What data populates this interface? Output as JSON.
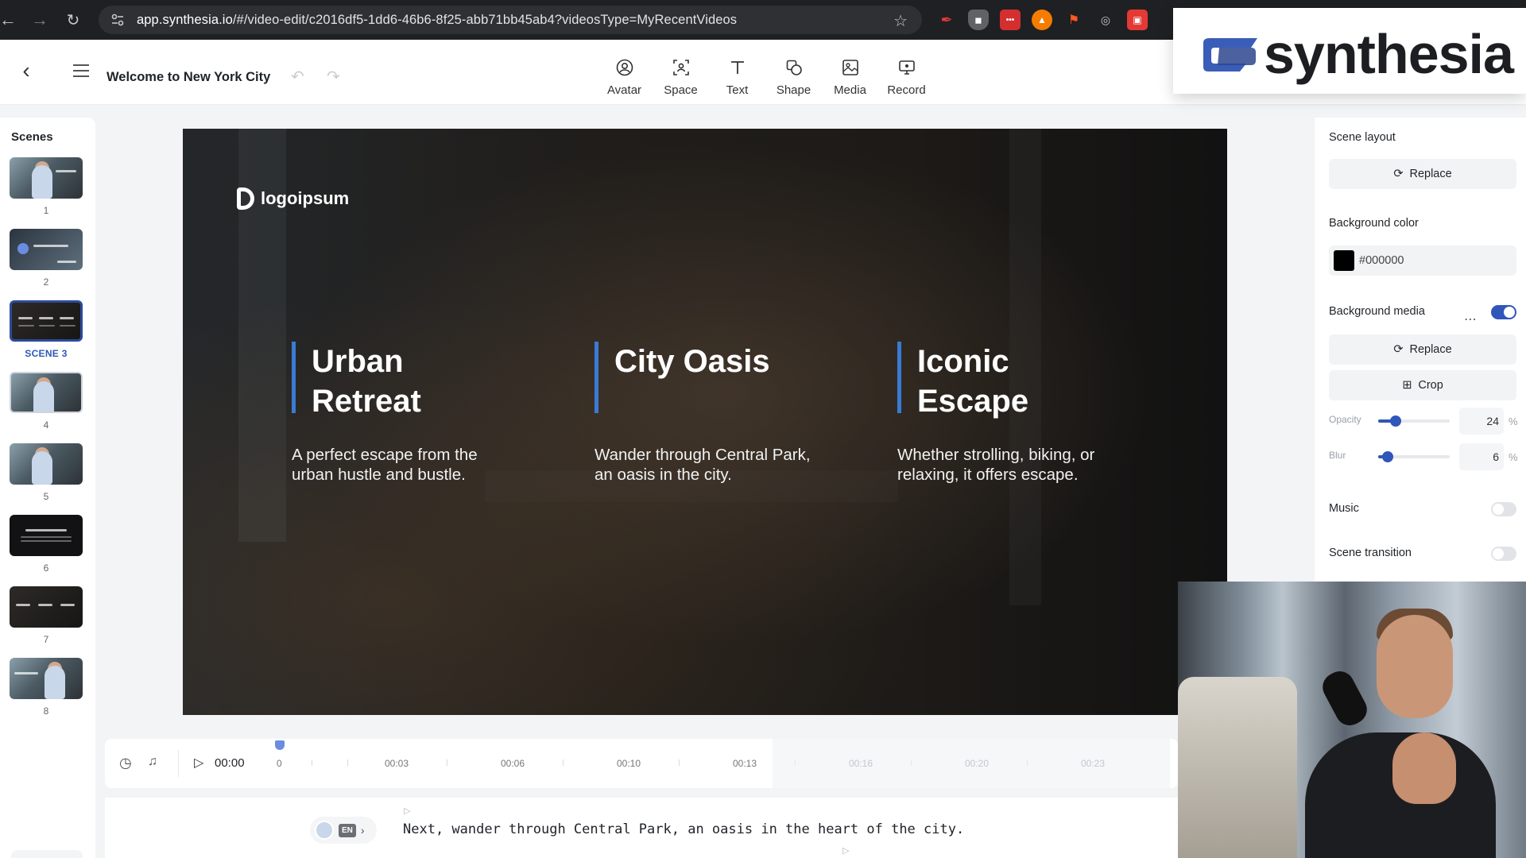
{
  "browser": {
    "url_host": "app.synthesia.io",
    "url_path": "/#/video-edit/c2016df5-1dd6-46b6-8f25-abb71bb45ab4?videosType=MyRecentVideos"
  },
  "header": {
    "video_title": "Welcome to New York City",
    "tools": [
      {
        "label": "Avatar",
        "icon": "avatar-icon"
      },
      {
        "label": "Space",
        "icon": "space-icon"
      },
      {
        "label": "Text",
        "icon": "text-icon"
      },
      {
        "label": "Shape",
        "icon": "shape-icon"
      },
      {
        "label": "Media",
        "icon": "media-icon"
      },
      {
        "label": "Record",
        "icon": "record-icon"
      }
    ]
  },
  "brand_overlay": {
    "wordmark": "synthesia"
  },
  "sidebar": {
    "title": "Scenes",
    "scenes": [
      {
        "label": "1",
        "style": "photo"
      },
      {
        "label": "2",
        "style": "photo"
      },
      {
        "label": "SCENE 3",
        "style": "dark",
        "selected": true
      },
      {
        "label": "4",
        "style": "photo"
      },
      {
        "label": "5",
        "style": "photo"
      },
      {
        "label": "6",
        "style": "dark"
      },
      {
        "label": "7",
        "style": "dark"
      },
      {
        "label": "8",
        "style": "photo"
      }
    ],
    "add_label": "+"
  },
  "canvas": {
    "logo_text": "logoipsum",
    "columns": [
      {
        "title_line1": "Urban",
        "title_line2": "Retreat",
        "desc_line1": "A perfect escape from the",
        "desc_line2": "urban hustle and bustle."
      },
      {
        "title_line1": "City Oasis",
        "title_line2": "",
        "desc_line1": "Wander through Central Park,",
        "desc_line2": "an oasis in the city."
      },
      {
        "title_line1": "Iconic",
        "title_line2": "Escape",
        "desc_line1": "Whether strolling, biking, or",
        "desc_line2": "relaxing, it offers escape."
      }
    ],
    "accent_color": "#3a7bd5"
  },
  "right_panel": {
    "scene_layout_label": "Scene layout",
    "replace_label": "Replace",
    "background_color_label": "Background color",
    "background_color_value": "#000000",
    "background_media_label": "Background media",
    "background_media_on": true,
    "crop_label": "Crop",
    "opacity_label": "Opacity",
    "opacity_value": "24",
    "blur_label": "Blur",
    "blur_value": "6",
    "unit": "%",
    "music_label": "Music",
    "music_on": false,
    "transition_label": "Scene transition",
    "transition_on": false
  },
  "timeline": {
    "current_time": "00:00",
    "ticks": [
      "0",
      "00:03",
      "00:06",
      "00:10",
      "00:13",
      "00:16",
      "00:20",
      "00:23"
    ]
  },
  "script": {
    "language": "EN",
    "text": "Next, wander through Central Park, an oasis in the heart of the city."
  }
}
